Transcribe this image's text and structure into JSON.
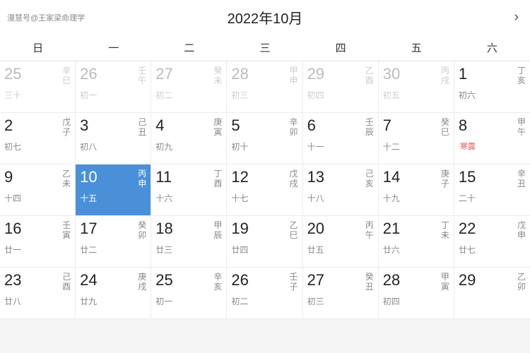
{
  "header": {
    "watermark": "漫慧号@王家梁命理学",
    "title": "2022年10月",
    "arrow": "›"
  },
  "weekdays": [
    "日",
    "一",
    "二",
    "三",
    "四",
    "五",
    "六"
  ],
  "weeks": [
    [
      {
        "num": "25",
        "gray": true,
        "gz": "辛\n巳",
        "lunar": "三十",
        "grayAll": true
      },
      {
        "num": "26",
        "gray": true,
        "gz": "壬\n午",
        "lunar": "初一",
        "grayAll": true
      },
      {
        "num": "27",
        "gray": true,
        "gz": "癸\n未",
        "lunar": "初二",
        "grayAll": true
      },
      {
        "num": "28",
        "gray": true,
        "gz": "甲\n申",
        "lunar": "初三",
        "grayAll": true
      },
      {
        "num": "29",
        "gray": true,
        "gz": "乙\n酉",
        "lunar": "初四",
        "grayAll": true
      },
      {
        "num": "30",
        "gray": true,
        "gz": "丙\n戌",
        "lunar": "初五",
        "grayAll": true
      },
      {
        "num": "1",
        "gz": "丁\n亥",
        "lunar": "初六"
      }
    ],
    [
      {
        "num": "2",
        "gz": "戊\n子",
        "lunar": "初七"
      },
      {
        "num": "3",
        "gz": "己\n丑",
        "lunar": "初八"
      },
      {
        "num": "4",
        "gz": "庚\n寅",
        "lunar": "初九"
      },
      {
        "num": "5",
        "gz": "辛\n卯",
        "lunar": "初十"
      },
      {
        "num": "6",
        "gz": "壬\n辰",
        "lunar": "十一"
      },
      {
        "num": "7",
        "gz": "癸\n巳",
        "lunar": "十二"
      },
      {
        "num": "8",
        "gz": "甲\n午",
        "lunar": "寒露",
        "solarTerm": true
      }
    ],
    [
      {
        "num": "9",
        "gz": "乙\n未",
        "lunar": "十四"
      },
      {
        "num": "10",
        "gz": "丙\n申",
        "lunar": "十五",
        "today": true
      },
      {
        "num": "11",
        "gz": "丁\n酉",
        "lunar": "十六"
      },
      {
        "num": "12",
        "gz": "戊\n戌",
        "lunar": "十七"
      },
      {
        "num": "13",
        "gz": "己\n亥",
        "lunar": "十八"
      },
      {
        "num": "14",
        "gz": "庚\n子",
        "lunar": "十九"
      },
      {
        "num": "15",
        "gz": "辛\n丑",
        "lunar": "二十"
      }
    ],
    [
      {
        "num": "16",
        "gz": "壬\n寅",
        "lunar": "廿一"
      },
      {
        "num": "17",
        "gz": "癸\n卯",
        "lunar": "廿二"
      },
      {
        "num": "18",
        "gz": "甲\n辰",
        "lunar": "廿三"
      },
      {
        "num": "19",
        "gz": "乙\n巳",
        "lunar": "廿四"
      },
      {
        "num": "20",
        "gz": "丙\n午",
        "lunar": "廿五"
      },
      {
        "num": "21",
        "gz": "丁\n未",
        "lunar": "廿六"
      },
      {
        "num": "22",
        "gz": "戊\n申",
        "lunar": "廿七"
      }
    ],
    [
      {
        "num": "23",
        "gz": "己\n酉",
        "lunar": "廿八"
      },
      {
        "num": "24",
        "gz": "庚\n戌",
        "lunar": "廿九"
      },
      {
        "num": "25",
        "gz": "辛\n亥",
        "lunar": "初一"
      },
      {
        "num": "26",
        "gz": "壬\n子",
        "lunar": "初二"
      },
      {
        "num": "27",
        "gz": "癸\n丑",
        "lunar": "初三"
      },
      {
        "num": "28",
        "gz": "甲\n寅",
        "lunar": "初四"
      },
      {
        "num": "29",
        "gz": "乙\n卯",
        "lunar": ""
      }
    ]
  ]
}
